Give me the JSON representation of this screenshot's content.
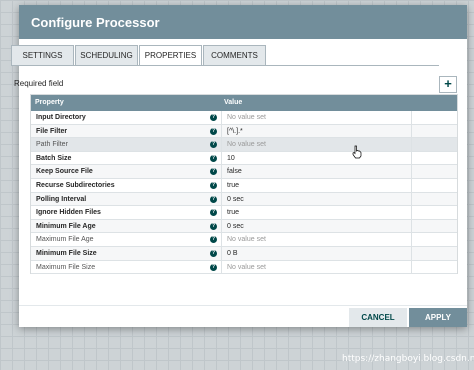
{
  "dialog": {
    "title": "Configure Processor"
  },
  "tabs": [
    {
      "label": "SETTINGS"
    },
    {
      "label": "SCHEDULING"
    },
    {
      "label": "PROPERTIES",
      "active": true
    },
    {
      "label": "COMMENTS"
    }
  ],
  "properties_panel": {
    "required_field_label": "Required field",
    "add_button_label": "+",
    "columns": {
      "property": "Property",
      "value": "Value"
    },
    "help_icon_glyph": "?",
    "rows": [
      {
        "name": "Input Directory",
        "value": "No value set",
        "required": true,
        "unset": true
      },
      {
        "name": "File Filter",
        "value": "[^\\.].*",
        "required": true,
        "unset": false
      },
      {
        "name": "Path Filter",
        "value": "No value set",
        "required": false,
        "unset": true
      },
      {
        "name": "Batch Size",
        "value": "10",
        "required": true,
        "unset": false
      },
      {
        "name": "Keep Source File",
        "value": "false",
        "required": true,
        "unset": false
      },
      {
        "name": "Recurse Subdirectories",
        "value": "true",
        "required": true,
        "unset": false
      },
      {
        "name": "Polling Interval",
        "value": "0 sec",
        "required": true,
        "unset": false
      },
      {
        "name": "Ignore Hidden Files",
        "value": "true",
        "required": true,
        "unset": false
      },
      {
        "name": "Minimum File Age",
        "value": "0 sec",
        "required": true,
        "unset": false
      },
      {
        "name": "Maximum File Age",
        "value": "No value set",
        "required": false,
        "unset": true
      },
      {
        "name": "Minimum File Size",
        "value": "0 B",
        "required": true,
        "unset": false
      },
      {
        "name": "Maximum File Size",
        "value": "No value set",
        "required": false,
        "unset": true
      }
    ]
  },
  "footer": {
    "cancel_label": "CANCEL",
    "apply_label": "APPLY"
  },
  "watermark": "https://zhangboyi.blog.csdn.net",
  "colors": {
    "header": "#728e9b",
    "accent": "#004849",
    "tab_inactive": "#e3e8eb",
    "canvas": "#cdd3d6"
  }
}
